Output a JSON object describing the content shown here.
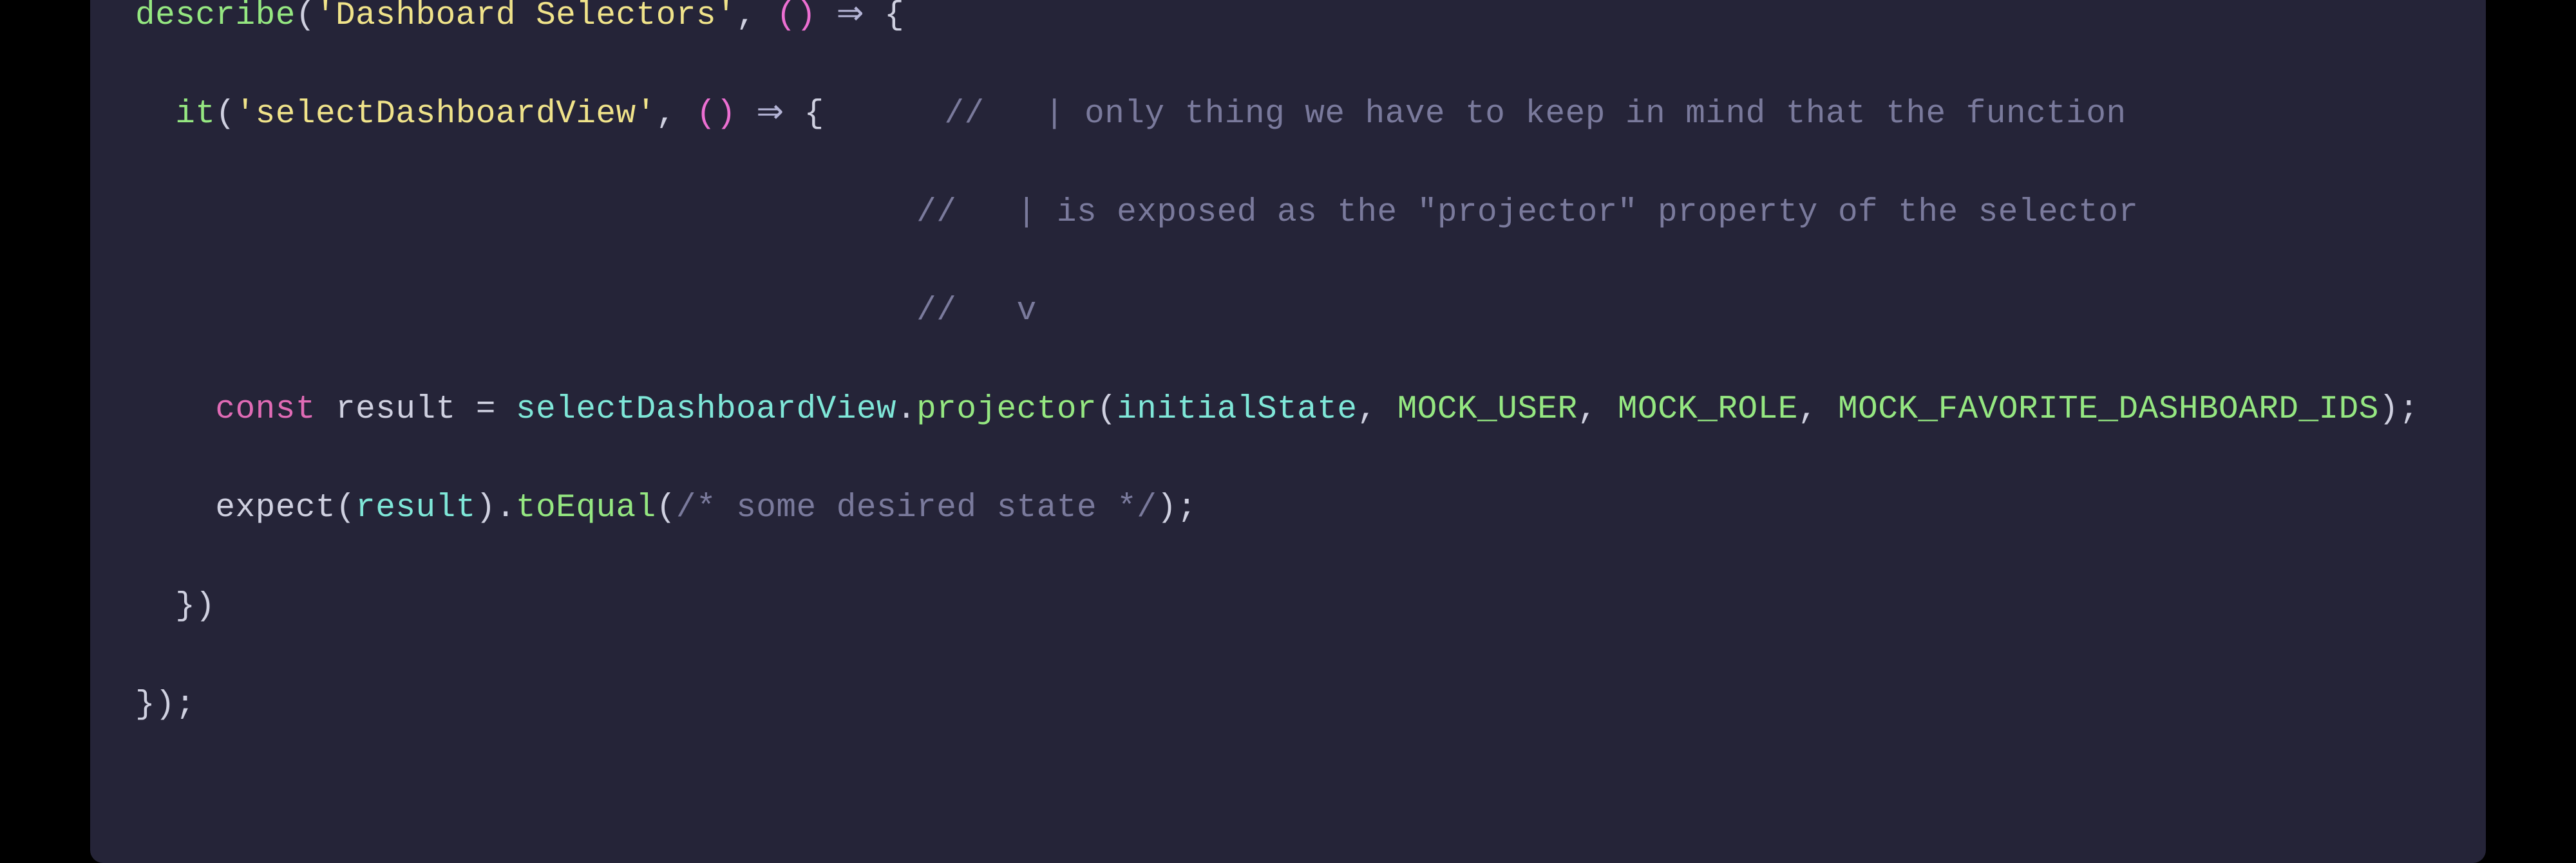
{
  "code": {
    "line1": {
      "describe": "describe",
      "op": "(",
      "str": "'Dashboard Selectors'",
      "cm": ", ",
      "paren": "()",
      "sp": " ",
      "arrow": "⇒",
      "sp2": " ",
      "brace": "{"
    },
    "line2": {
      "indent": "  ",
      "it": "it",
      "op": "(",
      "str": "'selectDashboardView'",
      "cm": ", ",
      "paren": "()",
      "sp": " ",
      "arrow": "⇒",
      "sp2": " ",
      "brace": "{",
      "pad": "      ",
      "comment": "//   | only thing we have to keep in mind that the function"
    },
    "line3": {
      "pad": "                                       ",
      "comment": "//   | is exposed as the \"projector\" property of the selector"
    },
    "line4": {
      "pad": "                                       ",
      "comment": "//   v"
    },
    "line5": {
      "indent": "    ",
      "const": "const",
      "sp": " ",
      "var": "result",
      "sp2": " ",
      "eq": "=",
      "sp3": " ",
      "ident": "selectDashboardView",
      "dot": ".",
      "method": "projector",
      "op": "(",
      "arg1": "initialState",
      "c1": ", ",
      "arg2": "MOCK_USER",
      "c2": ", ",
      "arg3": "MOCK_ROLE",
      "c3": ", ",
      "arg4": "MOCK_FAVORITE_DASHBOARD_IDS",
      "cp": ")",
      "semi": ";"
    },
    "line6": {
      "indent": "    ",
      "expect": "expect",
      "op": "(",
      "arg": "result",
      "cp": ")",
      "dot": ".",
      "method": "toEqual",
      "op2": "(",
      "comment": "/* some desired state */",
      "cp2": ")",
      "semi": ";"
    },
    "line7": {
      "indent": "  ",
      "close": "})"
    },
    "line8": {
      "close": "});"
    }
  }
}
